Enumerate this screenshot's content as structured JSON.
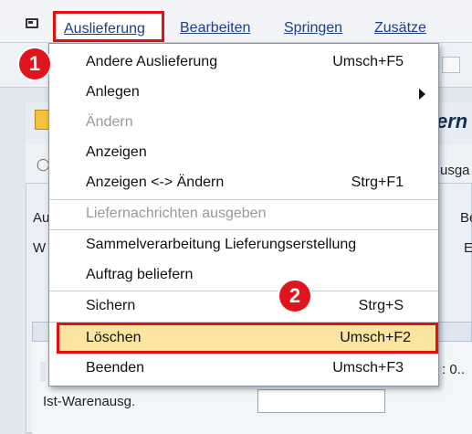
{
  "menubar": {
    "items": [
      "Auslieferung",
      "Bearbeiten",
      "Springen",
      "Zusätze"
    ]
  },
  "background": {
    "title_fragment": "ern",
    "sub_fragment": "usga",
    "labels_left": [
      "Au",
      "W"
    ],
    "labels_right": [
      "Be",
      "E"
    ],
    "trunc_value": ": 0..",
    "field_label": "Ist-Warenausg.",
    "field_value": ""
  },
  "dropdown": {
    "items": [
      {
        "label": "Andere Auslieferung",
        "shortcut": "Umsch+F5",
        "enabled": true
      },
      {
        "label": "Anlegen",
        "shortcut": "",
        "enabled": true,
        "submenu": true
      },
      {
        "label": "Ändern",
        "shortcut": "",
        "enabled": false
      },
      {
        "label": "Anzeigen",
        "shortcut": "",
        "enabled": true
      },
      {
        "label": "Anzeigen <-> Ändern",
        "shortcut": "Strg+F1",
        "enabled": true
      },
      {
        "label": "Liefernachrichten ausgeben",
        "shortcut": "",
        "enabled": false
      },
      {
        "label": "Sammelverarbeitung Lieferungserstellung",
        "shortcut": "",
        "enabled": true
      },
      {
        "label": "Auftrag beliefern",
        "shortcut": "",
        "enabled": true
      },
      {
        "label": "Sichern",
        "shortcut": "Strg+S",
        "enabled": true
      },
      {
        "label": "Löschen",
        "shortcut": "Umsch+F2",
        "enabled": true,
        "highlighted": true
      },
      {
        "label": "Beenden",
        "shortcut": "Umsch+F3",
        "enabled": true
      }
    ]
  },
  "annotations": {
    "step1": "1",
    "step2": "2",
    "color": "#e01010"
  }
}
